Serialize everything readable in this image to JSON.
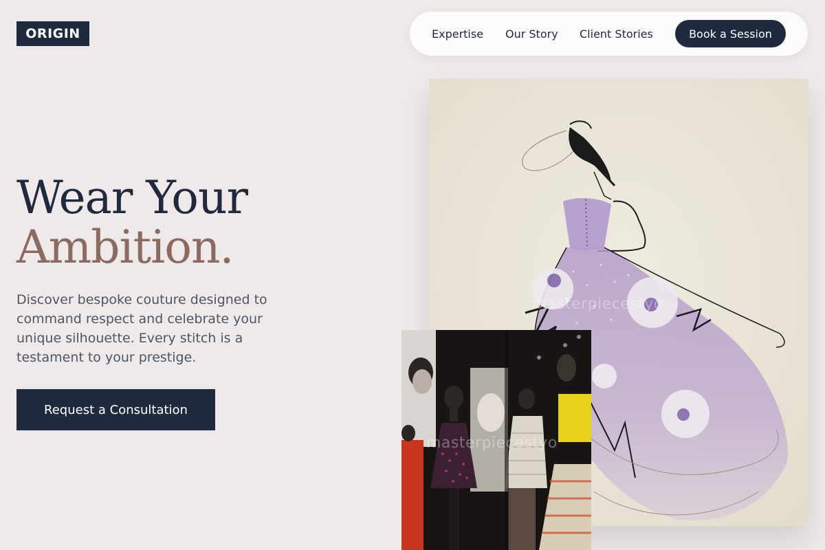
{
  "brand": {
    "logo_text": "ORIGIN"
  },
  "nav": {
    "links": [
      "Expertise",
      "Our Story",
      "Client Stories"
    ],
    "cta_label": "Book a Session"
  },
  "hero": {
    "title_line1": "Wear Your",
    "title_line2": "Ambition.",
    "description": "Discover bespoke couture designed to command respect and celebrate your unique silhouette. Every stitch is a testament to your prestige.",
    "button_label": "Request a Consultation"
  },
  "images": {
    "sketch": {
      "watermark": "masterpiecestyo"
    },
    "photo": {
      "watermark": "masterpiecestyo"
    }
  },
  "colors": {
    "background": "#efeae9",
    "navy": "#1f2a3f",
    "accent_brown": "#8b6a5f",
    "body_text": "#4a5568"
  }
}
